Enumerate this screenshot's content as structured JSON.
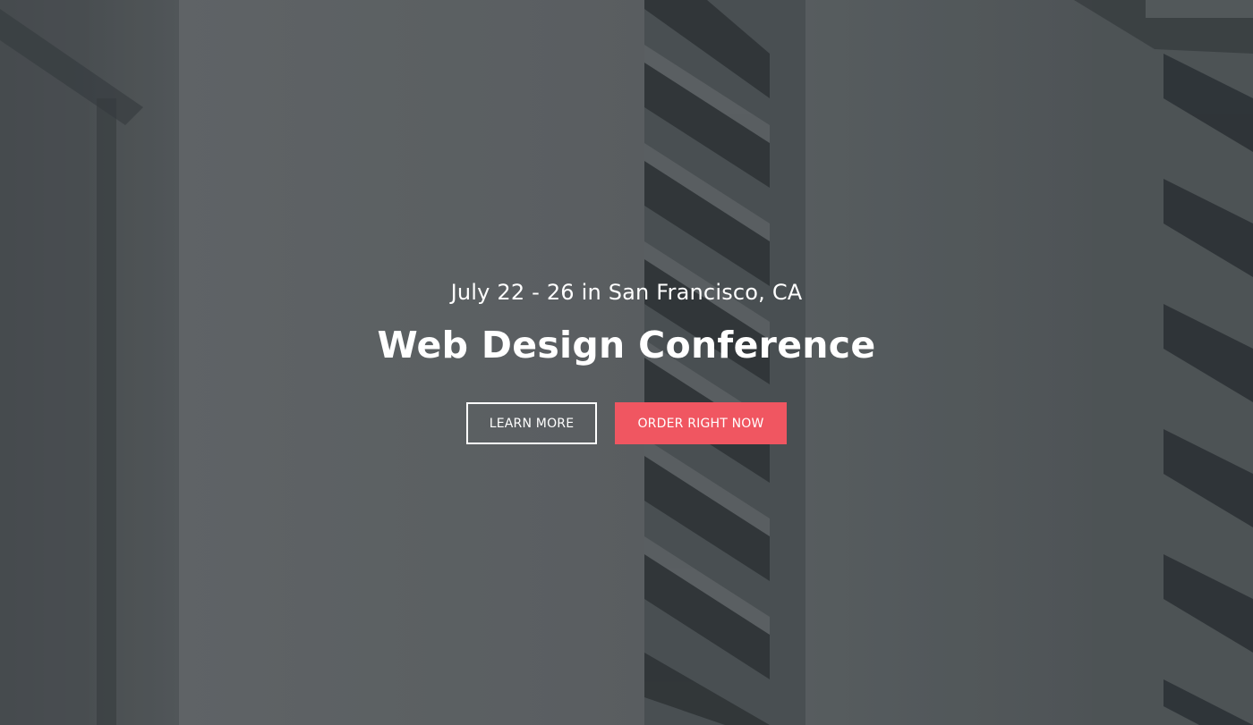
{
  "hero": {
    "date_location": "July 22 - 26 in San Francisco, CA",
    "title": "Web Design Conference",
    "learn_more_label": "LEARN MORE",
    "order_label": "ORDER RIGHT NOW"
  },
  "colors": {
    "primary_button": "#f05661",
    "text": "#ffffff",
    "background": "#5b6062"
  }
}
